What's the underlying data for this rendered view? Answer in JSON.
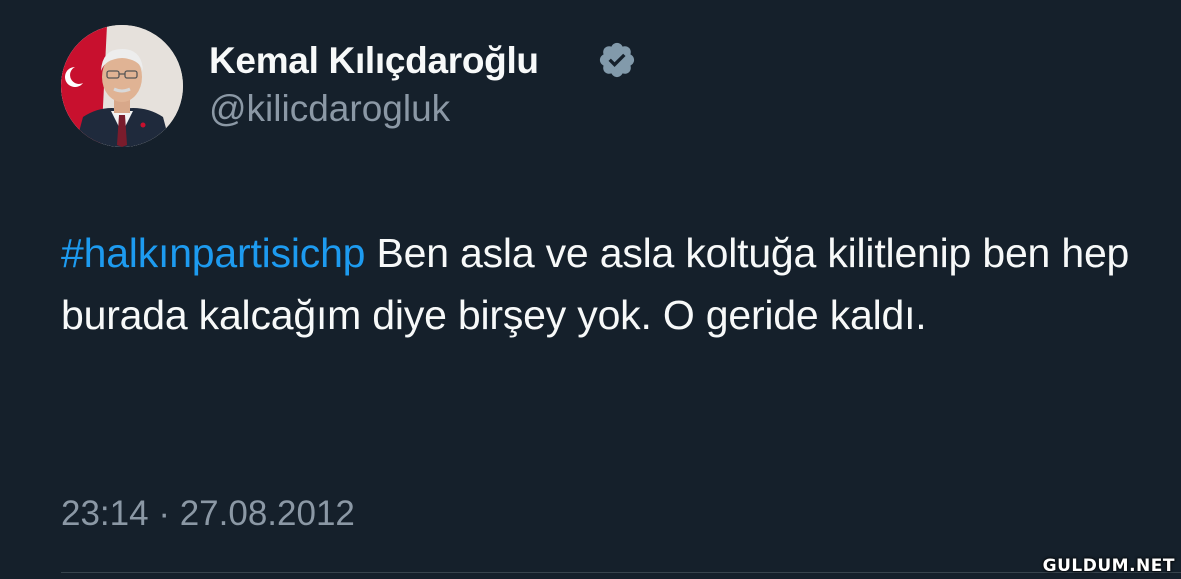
{
  "tweet": {
    "author": {
      "display_name": "Kemal Kılıçdaroğlu",
      "handle": "@kilicdarogluk",
      "verified_icon": "verified-badge-icon",
      "avatar": "avatar-photo"
    },
    "hashtag": "#halkınpartisichp",
    "text": " Ben asla ve asla koltuğa kilitlenip ben hep burada kalcağım diye birşey yok. O geride kaldı.",
    "time": "23:14",
    "separator": "·",
    "date": "27.08.2012"
  },
  "watermark": "GULDUM.NET",
  "colors": {
    "background": "#15202b",
    "text": "#f7f9f9",
    "secondary": "#8b98a5",
    "link": "#1d9bf0",
    "divider": "#38444d"
  }
}
